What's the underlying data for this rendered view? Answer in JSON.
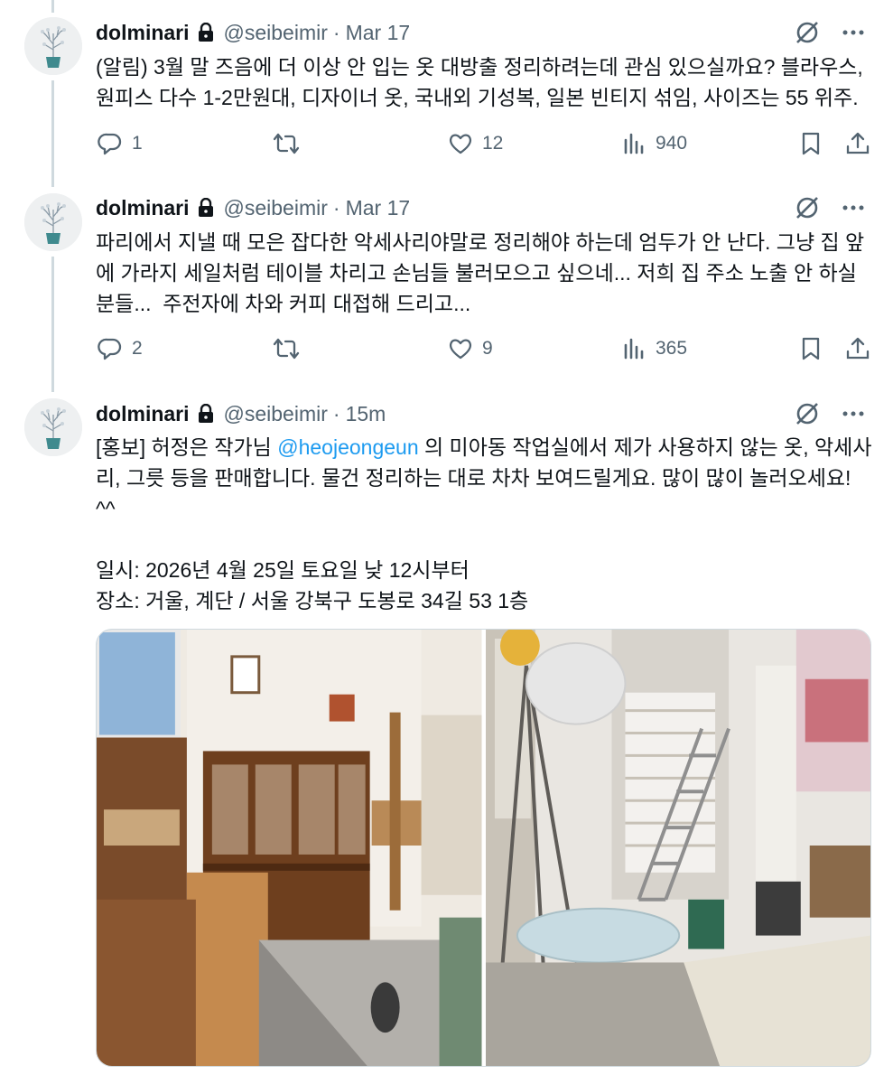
{
  "tweets": [
    {
      "name": "dolminari",
      "handle": "@seibeimir",
      "dot": "·",
      "time": "Mar 17",
      "text": "(알림) 3월 말 즈음에 더 이상 안 입는 옷 대방출 정리하려는데 관심 있으실까요? 블라우스, 원피스 다수 1-2만원대, 디자이너 옷, 국내외 기성복, 일본 빈티지 섞임, 사이즈는 55 위주.",
      "replies": "1",
      "retweets": "",
      "likes": "12",
      "views": "940"
    },
    {
      "name": "dolminari",
      "handle": "@seibeimir",
      "dot": "·",
      "time": "Mar 17",
      "text": "파리에서 지낼 때 모은 잡다한 악세사리야말로 정리해야 하는데 엄두가 안 난다. 그냥 집 앞에 가라지 세일처럼 테이블 차리고 손님들 불러모으고 싶으네... 저희 집 주소 노출 안 하실 분들...  주전자에 차와 커피 대접해 드리고...",
      "replies": "2",
      "retweets": "",
      "likes": "9",
      "views": "365"
    },
    {
      "name": "dolminari",
      "handle": "@seibeimir",
      "dot": "·",
      "time": "15m",
      "text_before": "[홍보] 허정은 작가님 ",
      "mention": "@heojeongeun",
      "text_after": " 의 미아동 작업실에서 제가 사용하지 않는 옷, 악세사리, 그릇 등을 판매합니다. 물건 정리하는 대로 차차 보여드릴게요. 많이 많이 놀러오세요! ^^\n\n일시: 2026년 4월 25일 토요일 낮 12시부터\n장소: 거울, 계단 / 서울 강북구 도봉로 34길 53 1층"
    }
  ],
  "colors": {
    "text": "#0f1419",
    "secondary": "#536471",
    "link": "#1d9bf0",
    "border": "#cfd9de"
  },
  "icons": [
    "lock-icon",
    "grok-icon",
    "more-icon",
    "reply-icon",
    "retweet-icon",
    "like-icon",
    "views-icon",
    "bookmark-icon",
    "share-icon"
  ]
}
